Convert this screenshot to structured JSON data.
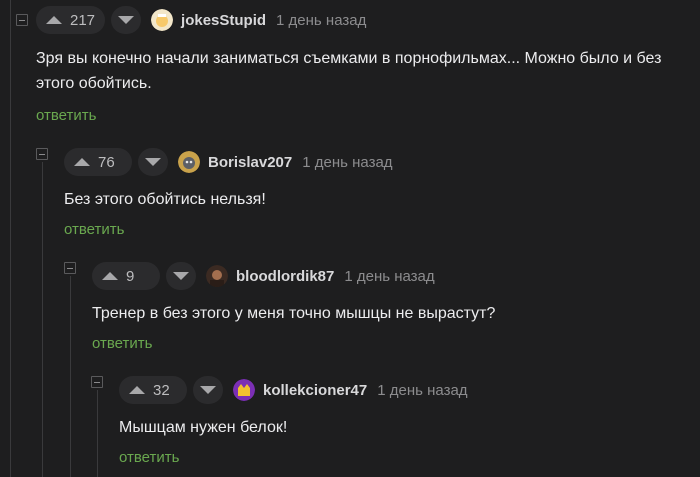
{
  "comments": [
    {
      "score": "217",
      "username": "jokesStupid",
      "time": "1 день назад",
      "text": "Зря вы конечно начали заниматься съемками в порнофильмах... Можно было и без этого обойтись.",
      "reply": "ответить"
    },
    {
      "score": "76",
      "username": "Borislav207",
      "time": "1 день назад",
      "text": "Без этого обойтись нельзя!",
      "reply": "ответить"
    },
    {
      "score": "9",
      "username": "bloodlordik87",
      "time": "1 день назад",
      "text": "Тренер в без этого у меня точно мышцы не вырастут?",
      "reply": "ответить"
    },
    {
      "score": "32",
      "username": "kollekcioner47",
      "time": "1 день назад",
      "text": "Мышцам нужен белок!",
      "reply": "ответить"
    }
  ],
  "colors": {
    "background": "#1e1e1f",
    "reply_link": "#6aa84f",
    "username": "#d8d8da",
    "time": "#8c8c8e"
  }
}
